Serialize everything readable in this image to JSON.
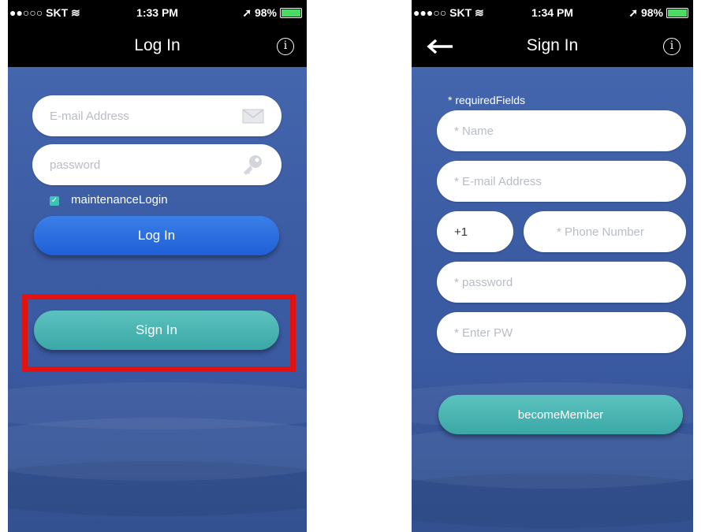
{
  "left_screen": {
    "status": {
      "carrier": "●●○○○ SKT ≋",
      "time": "1:33 PM",
      "battery": "➚ 98%"
    },
    "nav_title": "Log In",
    "email_placeholder": "E-mail Address",
    "password_placeholder": "password",
    "maintenance_label": "maintenanceLogin",
    "login_button": "Log In",
    "signin_button": "Sign In"
  },
  "right_screen": {
    "status": {
      "carrier": "●●●○○ SKT ≋",
      "time": "1:34 PM",
      "battery": "➚ 98%"
    },
    "nav_title": "Sign In",
    "required_note": "* requiredFields",
    "name_placeholder": "* Name",
    "email_placeholder": "* E-mail Address",
    "country_code": "+1",
    "phone_placeholder": "* Phone Number",
    "password_placeholder": "* password",
    "confirm_placeholder": "* Enter PW",
    "become_member_button": "becomeMember"
  },
  "colors": {
    "accent_blue": "#1f5fd6",
    "accent_teal": "#3aa8a6",
    "highlight_red": "#e01212",
    "checkbox_teal": "#3cc3b5"
  }
}
